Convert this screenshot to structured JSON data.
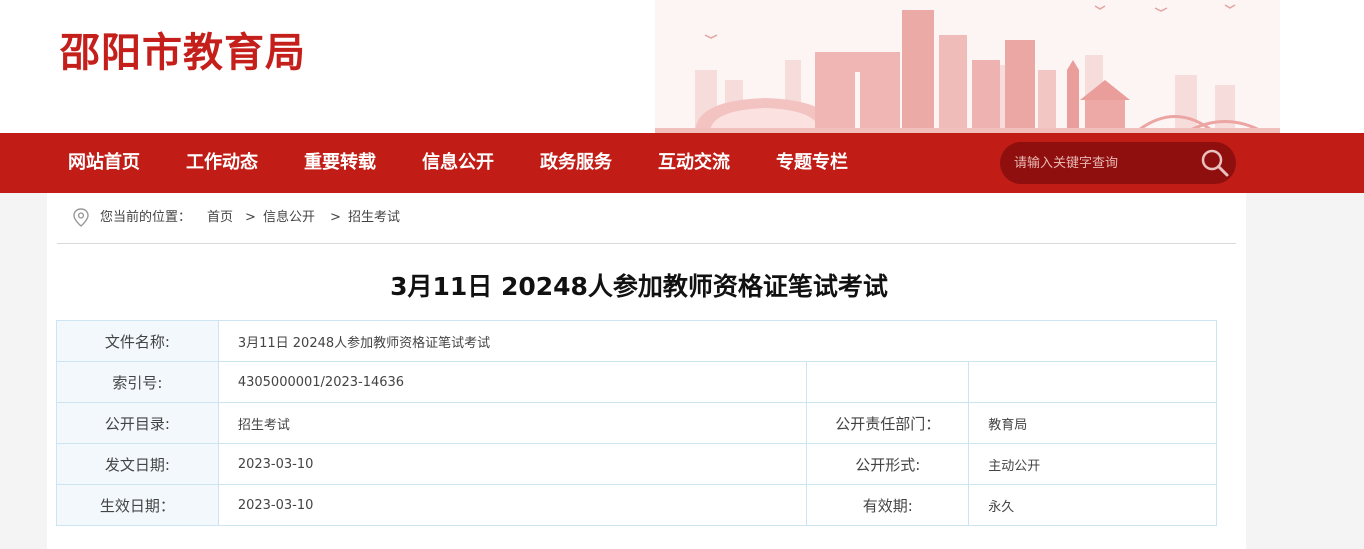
{
  "site": {
    "title": "邵阳市教育局"
  },
  "nav": {
    "items": [
      "网站首页",
      "工作动态",
      "重要转载",
      "信息公开",
      "政务服务",
      "互动交流",
      "专题专栏"
    ],
    "search_placeholder": "请输入关键字查询"
  },
  "breadcrumb": {
    "prefix": "您当前的位置：",
    "items": [
      "首页",
      "信息公开",
      "招生考试"
    ],
    "separator": ">"
  },
  "article": {
    "title": "3月11日 20248人参加教师资格证笔试考试"
  },
  "meta": {
    "file_name_label": "文件名称:",
    "file_name_value": "3月11日 20248人参加教师资格证笔试考试",
    "index_label": "索引号:",
    "index_value": "4305000001/2023-14636",
    "catalog_label": "公开目录:",
    "catalog_value": "招生考试",
    "dept_label": "公开责任部门：",
    "dept_value": "教育局",
    "issue_date_label": "发文日期:",
    "issue_date_value": "2023-03-10",
    "form_label": "公开形式:",
    "form_value": "主动公开",
    "effective_date_label": "生效日期：",
    "effective_date_value": "2023-03-10",
    "validity_label": "有效期:",
    "validity_value": "永久"
  },
  "colors": {
    "brand_red": "#c11c16",
    "title_red": "#c41f1a",
    "search_bg": "#8e0f0d",
    "table_border": "#cde4f3",
    "label_bg": "#f2f8fc"
  }
}
